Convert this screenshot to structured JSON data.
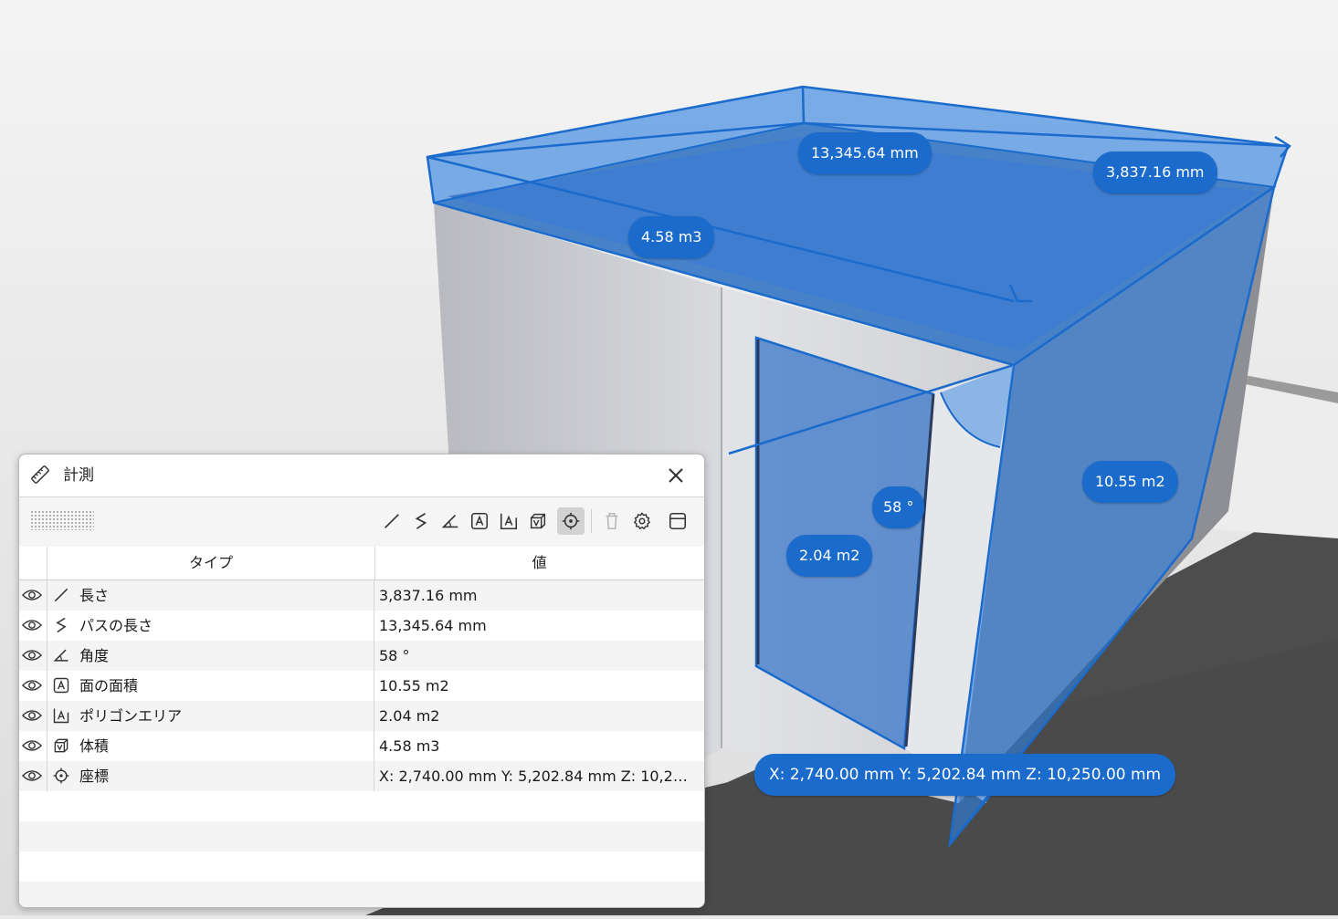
{
  "scene": {
    "labels": {
      "path_length": "13,345.64 mm",
      "length": "3,837.16 mm",
      "volume": "4.58 m3",
      "angle": "58 °",
      "face_area": "10.55 m2",
      "polygon_area": "2.04 m2",
      "coordinate": "X: 2,740.00 mm Y: 5,202.84 mm Z: 10,250.00 mm"
    },
    "colors": {
      "accent": "#1a6bcc",
      "overlay": "#2f7fe0"
    }
  },
  "panel": {
    "title": "計測",
    "title_icon": "ruler-icon",
    "toolbar": [
      {
        "name": "length-tool",
        "icon": "line-icon"
      },
      {
        "name": "path-length-tool",
        "icon": "path-icon"
      },
      {
        "name": "angle-tool",
        "icon": "angle-icon"
      },
      {
        "name": "face-area-tool",
        "icon": "face-area-icon"
      },
      {
        "name": "polygon-area-tool",
        "icon": "polygon-area-icon"
      },
      {
        "name": "volume-tool",
        "icon": "volume-icon"
      },
      {
        "name": "coordinate-tool",
        "icon": "target-icon",
        "active": true
      },
      {
        "name": "delete-tool",
        "icon": "trash-icon",
        "disabled": true
      },
      {
        "name": "settings-tool",
        "icon": "gear-icon"
      },
      {
        "name": "layout-tool",
        "icon": "panel-icon"
      }
    ],
    "columns": {
      "type": "タイプ",
      "value": "値"
    },
    "rows": [
      {
        "icon": "line-icon",
        "type": "長さ",
        "value": "3,837.16 mm"
      },
      {
        "icon": "path-icon",
        "type": "パスの長さ",
        "value": "13,345.64 mm"
      },
      {
        "icon": "angle-icon",
        "type": "角度",
        "value": "58 °"
      },
      {
        "icon": "face-area-icon",
        "type": "面の面積",
        "value": "10.55 m2"
      },
      {
        "icon": "polygon-area-icon",
        "type": "ポリゴンエリア",
        "value": "2.04 m2"
      },
      {
        "icon": "volume-icon",
        "type": "体積",
        "value": "4.58 m3"
      },
      {
        "icon": "target-icon",
        "type": "座標",
        "value": "X: 2,740.00 mm Y: 5,202.84 mm Z: 10,250.00 mm"
      }
    ]
  }
}
